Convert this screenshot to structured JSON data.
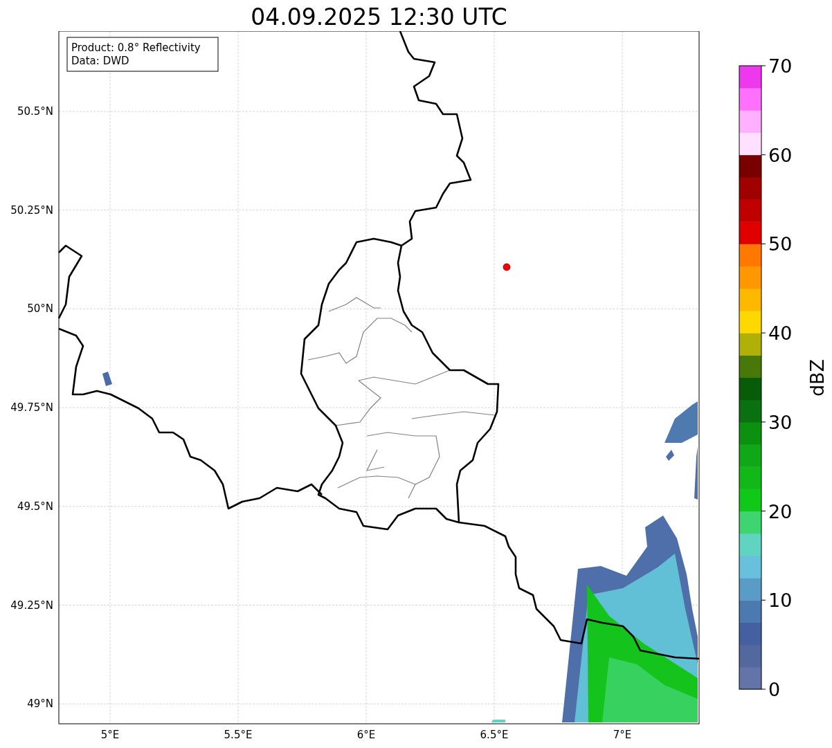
{
  "title": "04.09.2025 12:30 UTC",
  "annotation": [
    "Product: 0.8° Reflectivity",
    "Data: DWD"
  ],
  "x_ticks": [
    "5°E",
    "5.5°E",
    "6°E",
    "6.5°E",
    "7°E"
  ],
  "y_ticks": [
    "50.5°N",
    "50.25°N",
    "50°N",
    "49.75°N",
    "49.5°N",
    "49.25°N",
    "49°N"
  ],
  "colorbar": {
    "label": "dBZ",
    "ticks": [
      "70",
      "60",
      "50",
      "40",
      "30",
      "20",
      "10",
      "0"
    ],
    "bins": [
      {
        "color": "#6474a8"
      },
      {
        "color": "#5468a0"
      },
      {
        "color": "#4460a0"
      },
      {
        "color": "#4a7ab0"
      },
      {
        "color": "#5a9cc8"
      },
      {
        "color": "#68c0dc"
      },
      {
        "color": "#60d4c0"
      },
      {
        "color": "#3ed470"
      },
      {
        "color": "#10c818"
      },
      {
        "color": "#12b818"
      },
      {
        "color": "#10a818"
      },
      {
        "color": "#0c9010"
      },
      {
        "color": "#0a7010"
      },
      {
        "color": "#085c08"
      },
      {
        "color": "#487808"
      },
      {
        "color": "#b0b008"
      },
      {
        "color": "#ffd800"
      },
      {
        "color": "#ffb800"
      },
      {
        "color": "#ff9800"
      },
      {
        "color": "#ff7800"
      },
      {
        "color": "#e00000"
      },
      {
        "color": "#c00000"
      },
      {
        "color": "#a00000"
      },
      {
        "color": "#780000"
      },
      {
        "color": "#ffe0ff"
      },
      {
        "color": "#ffb0ff"
      },
      {
        "color": "#ff70ff"
      },
      {
        "color": "#ee38ee"
      }
    ]
  }
}
